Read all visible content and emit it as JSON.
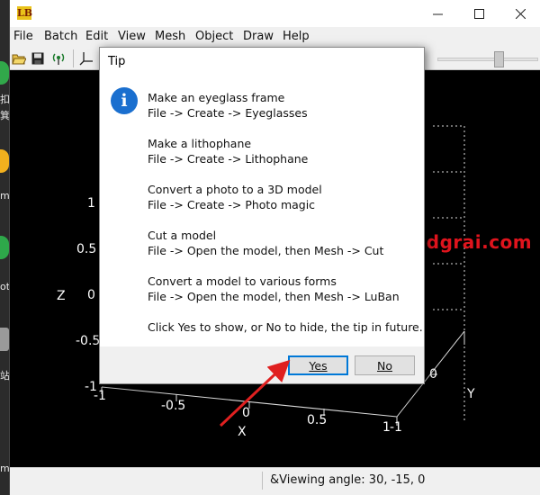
{
  "desktop": {
    "fragments": [
      "扣",
      "箕",
      "me",
      "ot",
      "站",
      "m"
    ]
  },
  "window": {
    "app_icon_text": "LB",
    "menu": [
      "File",
      "Batch",
      "Edit",
      "View",
      "Mesh",
      "Object",
      "Draw",
      "Help"
    ]
  },
  "viewport": {
    "z_ticks": [
      "1",
      "0.5",
      "0",
      "-0.5",
      "-1"
    ],
    "x_ticks": [
      "-1",
      "-0.5",
      "0",
      "0.5",
      "1"
    ],
    "y_ticks": [
      "-1",
      "0"
    ],
    "z_label": "Z",
    "x_label": "X",
    "y_label": "Y"
  },
  "status": {
    "viewing_angle": "&Viewing angle: 30, -15, 0"
  },
  "watermark": "www.dgrai.com",
  "dialog": {
    "title": "Tip",
    "icon_text": "i",
    "tips": [
      {
        "title": "Make an eyeglass frame",
        "path": "File -> Create -> Eyeglasses"
      },
      {
        "title": "Make a lithophane",
        "path": "File -> Create -> Lithophane"
      },
      {
        "title": "Convert a photo to a 3D model",
        "path": "File -> Create -> Photo magic"
      },
      {
        "title": "Cut a model",
        "path": "File -> Open the model, then Mesh -> Cut"
      },
      {
        "title": "Convert a model to various forms",
        "path": "File -> Open the model, then Mesh -> LuBan"
      }
    ],
    "footer_note": "Click Yes to show, or No to hide, the tip in future.",
    "yes_label": "Yes",
    "no_label": "No"
  },
  "colors": {
    "accent": "#0078d7",
    "info_icon": "#1a6fcf",
    "watermark": "#e0141d",
    "arrow": "#e02020"
  }
}
